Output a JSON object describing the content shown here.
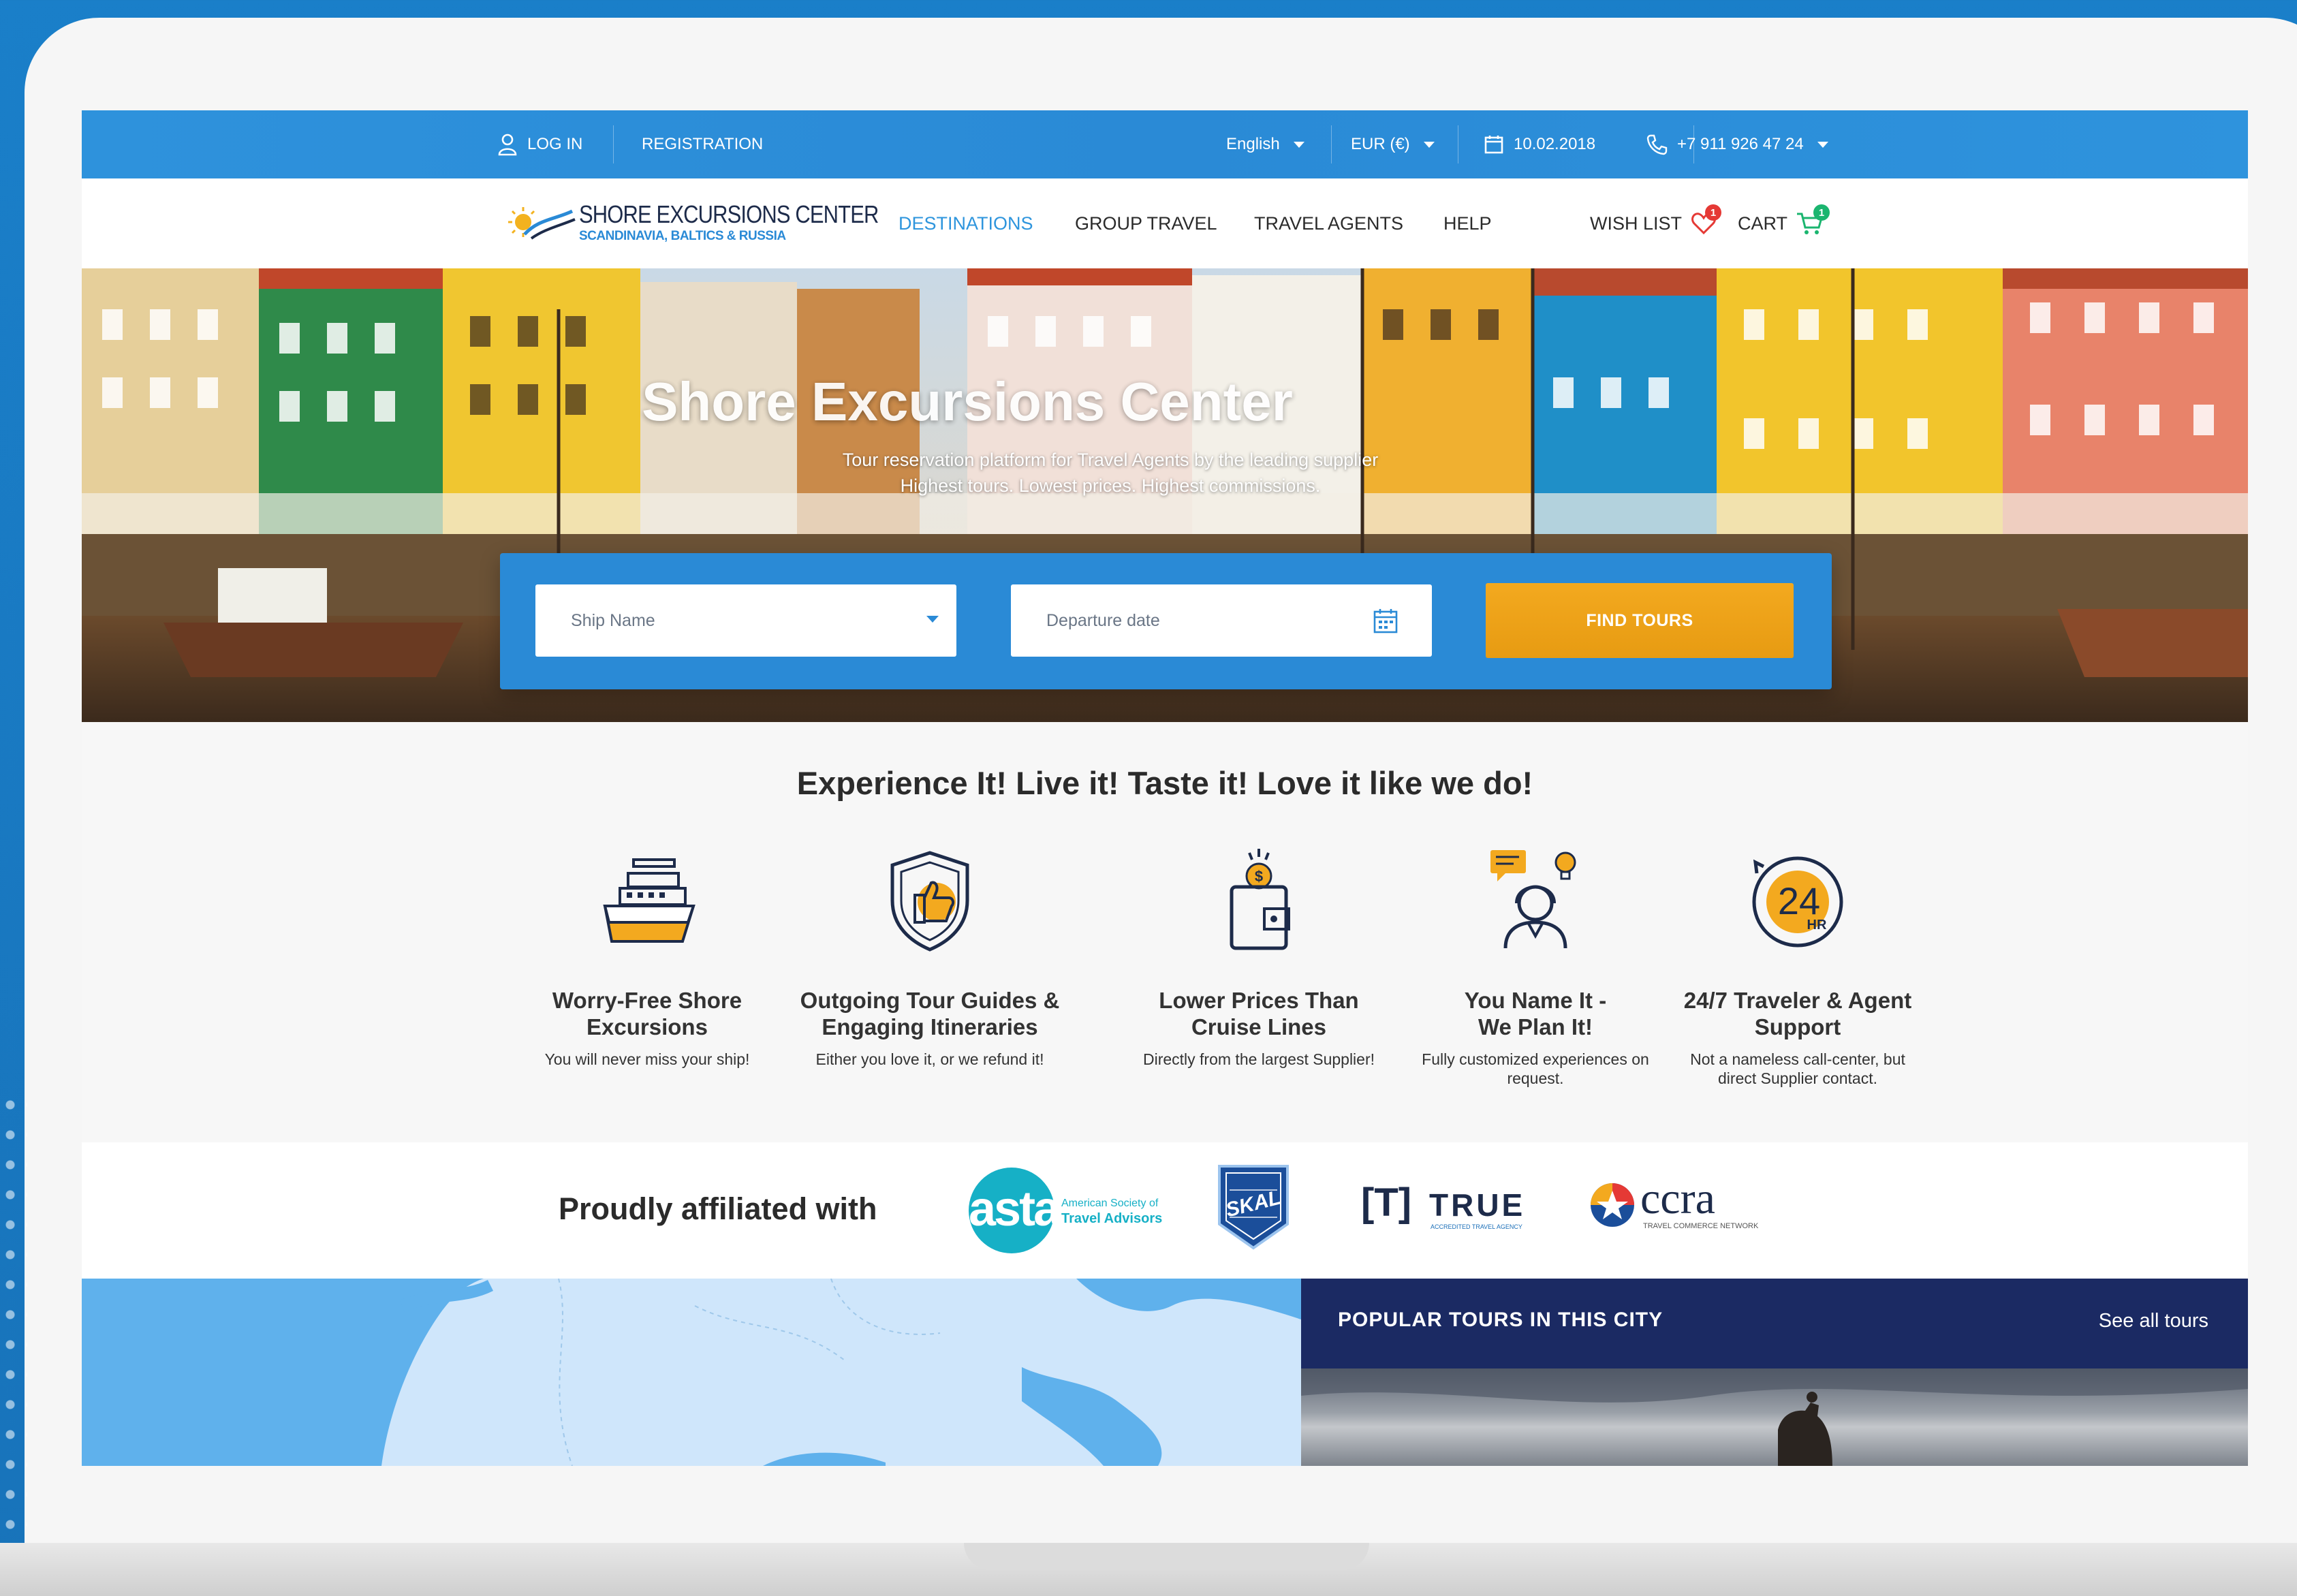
{
  "topbar": {
    "login": "LOG IN",
    "registration": "REGISTRATION",
    "language": "English",
    "currency": "EUR (€)",
    "date": "10.02.2018",
    "phone": "+7 911 926 47 24"
  },
  "logo": {
    "title": "SHORE EXCURSIONS CENTER",
    "subtitle": "SCANDINAVIA, BALTICS & RUSSIA"
  },
  "nav": {
    "destinations": "DESTINATIONS",
    "group_travel": "GROUP TRAVEL",
    "travel_agents": "TRAVEL AGENTS",
    "help": "HELP",
    "wish_list": "WISH LIST",
    "wish_count": "1",
    "cart": "CART",
    "cart_count": "1"
  },
  "hero": {
    "title": "Shore Excursions Center",
    "subtitle_1": "Tour reservation platform for Travel Agents by the leading supplier",
    "subtitle_2": "Highest tours. Lowest prices. Highest commissions."
  },
  "search": {
    "ship_placeholder": "Ship Name",
    "date_placeholder": "Departure date",
    "button": "FIND TOURS"
  },
  "tagline": "Experience It! Live it! Taste it! Love it like we do!",
  "features": [
    {
      "icon": "ship-icon",
      "title_1": "Worry-Free Shore",
      "title_2": "Excursions",
      "desc_1": "You will never miss your ship!",
      "desc_2": ""
    },
    {
      "icon": "shield-thumb-icon",
      "title_1": "Outgoing Tour Guides &",
      "title_2": "Engaging Itineraries",
      "desc_1": "Either you love it, or we refund it!",
      "desc_2": ""
    },
    {
      "icon": "wallet-icon",
      "title_1": "Lower Prices Than",
      "title_2": "Cruise Lines",
      "desc_1": "Directly from the largest Supplier!",
      "desc_2": ""
    },
    {
      "icon": "agent-idea-icon",
      "title_1": "You Name It -",
      "title_2": "We Plan It!",
      "desc_1": "Fully customized experiences on",
      "desc_2": "request."
    },
    {
      "icon": "support-24-icon",
      "title_1": "24/7 Traveler & Agent",
      "title_2": "Support",
      "desc_1": "Not a nameless call-center, but",
      "desc_2": "direct Supplier contact."
    }
  ],
  "affiliated": {
    "title": "Proudly affiliated with",
    "asta": "asta",
    "asta_sub_1": "American Society of",
    "asta_sub_2": "Travel Advisors",
    "skal": "SKAL",
    "true_left": "[T]",
    "true_word": "TRUE",
    "true_sub": "ACCREDITED TRAVEL AGENCY",
    "ccra": "ccra",
    "ccra_sub": "TRAVEL COMMERCE NETWORK"
  },
  "popular": {
    "title": "POPULAR TOURS IN THIS CITY",
    "see_all": "See all tours"
  },
  "colors": {
    "primary_blue": "#2a8ad6",
    "accent_orange": "#f3a91f",
    "navy": "#1b2a63",
    "badge_red": "#e53935",
    "badge_green": "#1bb56f"
  }
}
